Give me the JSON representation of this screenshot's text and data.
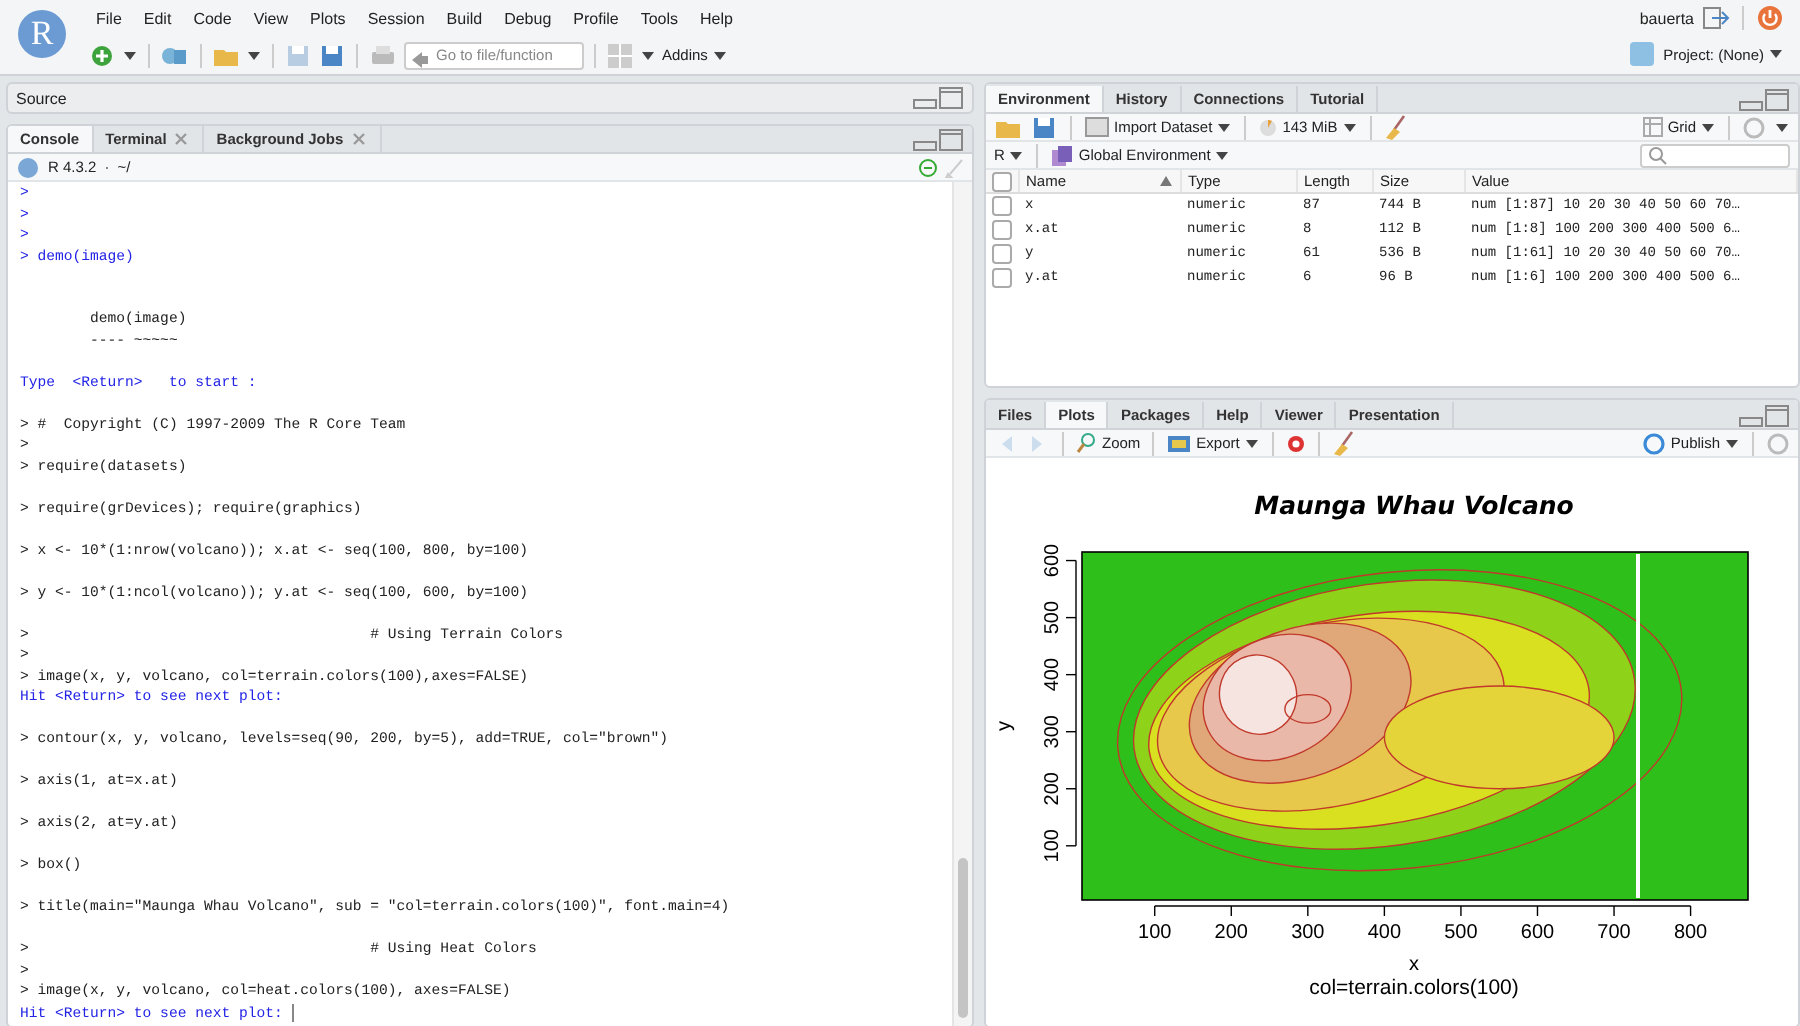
{
  "logo": "R",
  "menu": [
    "File",
    "Edit",
    "Code",
    "View",
    "Plots",
    "Session",
    "Build",
    "Debug",
    "Profile",
    "Tools",
    "Help"
  ],
  "toolbar": {
    "goto_placeholder": "Go to file/function",
    "addins": "Addins"
  },
  "user": "bauerta",
  "project": "Project: (None)",
  "source_pane": {
    "title": "Source"
  },
  "console": {
    "tabs": [
      {
        "label": "Console",
        "selected": true,
        "closable": false
      },
      {
        "label": "Terminal",
        "selected": false,
        "closable": true
      },
      {
        "label": "Background Jobs",
        "selected": false,
        "closable": true
      }
    ],
    "version": "R 4.3.2",
    "path_separator": "·",
    "path": "~/",
    "lines": [
      {
        "kind": "input",
        "text": ">"
      },
      {
        "kind": "input",
        "text": ">"
      },
      {
        "kind": "input",
        "text": ">"
      },
      {
        "kind": "input",
        "text": "> demo(image)"
      },
      {
        "kind": "blank"
      },
      {
        "kind": "blank"
      },
      {
        "kind": "output",
        "text": "        demo(image)"
      },
      {
        "kind": "output",
        "text": "        ---- ~~~~~"
      },
      {
        "kind": "blank"
      },
      {
        "kind": "input",
        "text": "Type  <Return>   to start :"
      },
      {
        "kind": "blank"
      },
      {
        "kind": "output",
        "text": "> #  Copyright (C) 1997-2009 The R Core Team"
      },
      {
        "kind": "output",
        "text": ">"
      },
      {
        "kind": "output",
        "text": "> require(datasets)"
      },
      {
        "kind": "blank"
      },
      {
        "kind": "output",
        "text": "> require(grDevices); require(graphics)"
      },
      {
        "kind": "blank"
      },
      {
        "kind": "output",
        "text": "> x <- 10*(1:nrow(volcano)); x.at <- seq(100, 800, by=100)"
      },
      {
        "kind": "blank"
      },
      {
        "kind": "output",
        "text": "> y <- 10*(1:ncol(volcano)); y.at <- seq(100, 600, by=100)"
      },
      {
        "kind": "blank"
      },
      {
        "kind": "output",
        "text": ">                                       # Using Terrain Colors"
      },
      {
        "kind": "output",
        "text": ">"
      },
      {
        "kind": "output",
        "text": "> image(x, y, volcano, col=terrain.colors(100),axes=FALSE)"
      },
      {
        "kind": "input",
        "text": "Hit <Return> to see next plot:"
      },
      {
        "kind": "blank"
      },
      {
        "kind": "output",
        "text": "> contour(x, y, volcano, levels=seq(90, 200, by=5), add=TRUE, col=\"brown\")"
      },
      {
        "kind": "blank"
      },
      {
        "kind": "output",
        "text": "> axis(1, at=x.at)"
      },
      {
        "kind": "blank"
      },
      {
        "kind": "output",
        "text": "> axis(2, at=y.at)"
      },
      {
        "kind": "blank"
      },
      {
        "kind": "output",
        "text": "> box()"
      },
      {
        "kind": "blank"
      },
      {
        "kind": "output",
        "text": "> title(main=\"Maunga Whau Volcano\", sub = \"col=terrain.colors(100)\", font.main=4)"
      },
      {
        "kind": "blank"
      },
      {
        "kind": "output",
        "text": ">                                       # Using Heat Colors"
      },
      {
        "kind": "output",
        "text": ">"
      },
      {
        "kind": "output",
        "text": "> image(x, y, volcano, col=heat.colors(100), axes=FALSE)"
      },
      {
        "kind": "input",
        "text": "Hit <Return> to see next plot: ",
        "cursor": true
      }
    ]
  },
  "environment": {
    "tabs": [
      {
        "label": "Environment",
        "selected": true
      },
      {
        "label": "History",
        "selected": false
      },
      {
        "label": "Connections",
        "selected": false
      },
      {
        "label": "Tutorial",
        "selected": false
      }
    ],
    "import": "Import Dataset",
    "memory": "143 MiB",
    "view": "Grid",
    "language": "R",
    "scope": "Global Environment",
    "all_checked": false,
    "columns": [
      {
        "label": "Name",
        "sorted": true
      },
      {
        "label": "Type",
        "sorted": false
      },
      {
        "label": "Length",
        "sorted": false
      },
      {
        "label": "Size",
        "sorted": false
      },
      {
        "label": "Value",
        "sorted": false
      }
    ],
    "rows": [
      {
        "name": "x",
        "type": "numeric",
        "length": "87",
        "size": "744 B",
        "value": "num [1:87] 10 20 30 40 50 60 70…",
        "checked": false
      },
      {
        "name": "x.at",
        "type": "numeric",
        "length": "8",
        "size": "112 B",
        "value": "num [1:8] 100 200 300 400 500 6…",
        "checked": false
      },
      {
        "name": "y",
        "type": "numeric",
        "length": "61",
        "size": "536 B",
        "value": "num [1:61] 10 20 30 40 50 60 70…",
        "checked": false
      },
      {
        "name": "y.at",
        "type": "numeric",
        "length": "6",
        "size": "96 B",
        "value": "num [1:6] 100 200 300 400 500 6…",
        "checked": false
      }
    ]
  },
  "files": {
    "tabs": [
      {
        "label": "Files",
        "selected": false
      },
      {
        "label": "Plots",
        "selected": true
      },
      {
        "label": "Packages",
        "selected": false
      },
      {
        "label": "Help",
        "selected": false
      },
      {
        "label": "Viewer",
        "selected": false
      },
      {
        "label": "Presentation",
        "selected": false
      }
    ],
    "zoom": "Zoom",
    "export": "Export",
    "publish": "Publish",
    "plot": {
      "title": "Maunga Whau Volcano",
      "xlabel": "x",
      "ylabel": "y",
      "subtitle": "col=terrain.colors(100)",
      "xticks": [
        "100",
        "200",
        "300",
        "400",
        "500",
        "600",
        "700",
        "800"
      ],
      "yticks": [
        "100",
        "200",
        "300",
        "400",
        "500",
        "600"
      ]
    }
  }
}
